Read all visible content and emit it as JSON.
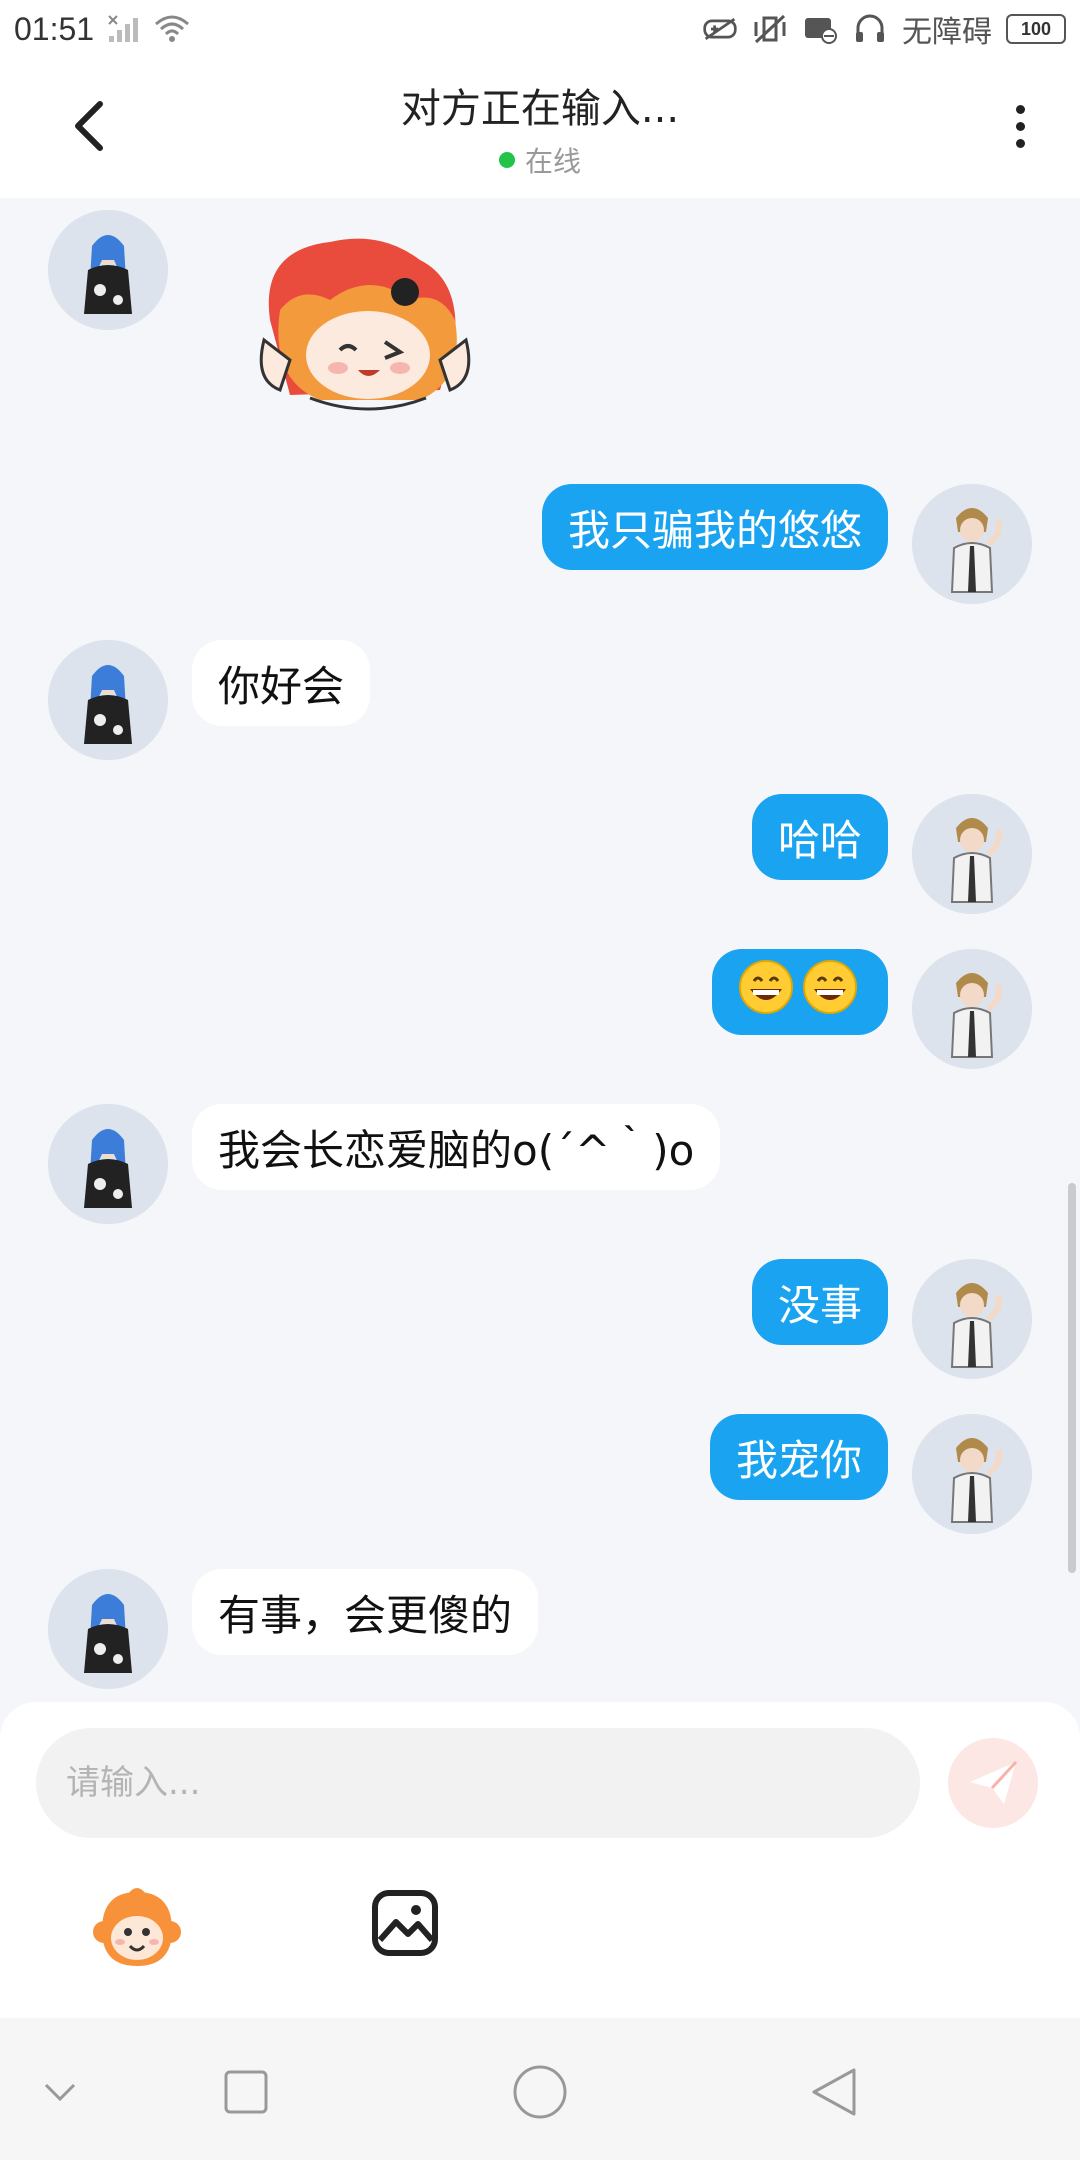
{
  "status_bar": {
    "time": "01:51",
    "accessibility_label": "无障碍",
    "battery": "100"
  },
  "header": {
    "title": "对方正在输入...",
    "status": "在线",
    "online_color": "#23c34a"
  },
  "messages": [
    {
      "side": "in",
      "type": "sticker",
      "sticker": "orange-haired-chibi-sticker"
    },
    {
      "side": "out",
      "text": "我只骗我的悠悠"
    },
    {
      "side": "in",
      "text": "你好会"
    },
    {
      "side": "out",
      "text": "哈哈"
    },
    {
      "side": "out",
      "text": "😄😄"
    },
    {
      "side": "in",
      "text": "我会长恋爱脑的o(´^｀)o"
    },
    {
      "side": "out",
      "text": "没事"
    },
    {
      "side": "out",
      "text": "我宠你"
    },
    {
      "side": "in",
      "text": "有事，会更傻的"
    }
  ],
  "input": {
    "placeholder": "请输入...",
    "value": ""
  },
  "toolbar": {
    "emoji_icon": "monkey-emoji-icon",
    "image_icon": "image-icon"
  },
  "colors": {
    "outgoing_bubble": "#1aa3f0",
    "incoming_bubble": "#ffffff",
    "background": "#f4f6f9",
    "send_button": "#f47a6c"
  }
}
